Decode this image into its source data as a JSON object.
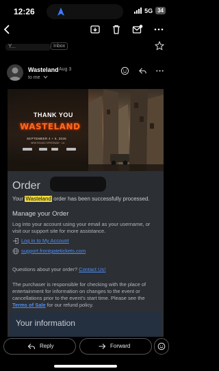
{
  "status_bar": {
    "time": "12:26",
    "network": "5G",
    "battery": "34"
  },
  "subject": {
    "text": "Y...",
    "label": "Inbox"
  },
  "sender": {
    "name": "Wasteland",
    "date": "Aug 3",
    "to": "to me"
  },
  "banner": {
    "heading": "THANK YOU",
    "logo": "WASTELAND",
    "dates": "SEPTEMBER 4 + 5, 2026",
    "location": "NEW ROADS SPEEDWAY · LA"
  },
  "email": {
    "order_title": "Order",
    "processed_prefix": "Your",
    "processed_highlight": "Wasteland",
    "processed_suffix": "order has been successfully processed.",
    "manage_title": "Manage your Order",
    "manage_desc": "Log into your account using your email as your username, or visit our support site for more assistance.",
    "link_login": "Log in to My Account",
    "link_support": "support.frontgatetickets.com",
    "question_prefix": "Questions about your order?",
    "question_link": "Contact Us!",
    "disclaimer_main": "The purchaser is responsible for checking with the place of entertainment for information on changes to the event or cancellations prior to the event's start time. Please see the",
    "disclaimer_link": "Terms of Sale",
    "disclaimer_end": "for our refund policy.",
    "info_title": "Your information"
  },
  "actions": {
    "reply": "Reply",
    "forward": "Forward"
  }
}
